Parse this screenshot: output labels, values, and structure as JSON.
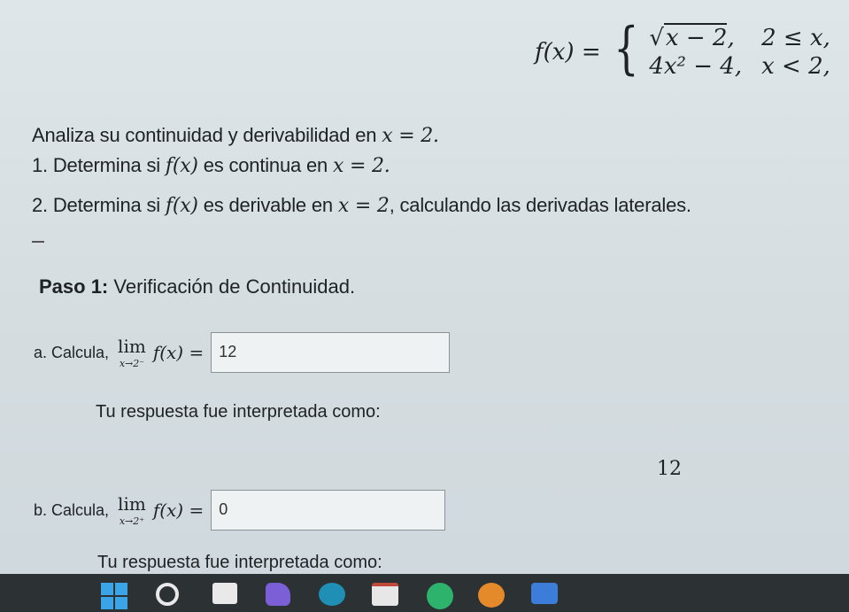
{
  "function": {
    "lhs": "f(x) =",
    "case1_expr": "x − 2",
    "case1_cond": "2 ≤ x,",
    "case2_expr": "4x² − 4,",
    "case2_cond": "x < 2,"
  },
  "statement": {
    "intro_text": "Analiza su continuidad y derivabilidad en",
    "intro_math": "x = 2.",
    "item1_a": "1. Determina si",
    "item1_fx": "f(x)",
    "item1_b": "es continua en",
    "item1_math": "x = 2.",
    "item2_a": "2. Determina si",
    "item2_fx": "f(x)",
    "item2_b": "es derivable en",
    "item2_math": "x = 2",
    "item2_c": ", calculando las derivadas laterales."
  },
  "separator": "---",
  "step1": {
    "label": "Paso 1:",
    "title": "Verificación de Continuidad."
  },
  "question_a": {
    "prefix": "a. Calcula,",
    "lim_word": "lim",
    "lim_sub": "x→2⁻",
    "fx": "f(x) =",
    "answer": "12"
  },
  "interpretation_a": {
    "label": "Tu respuesta fue interpretada como:",
    "value": "12"
  },
  "question_b": {
    "prefix": "b. Calcula,",
    "lim_word": "lim",
    "lim_sub": "x→2⁺",
    "fx": "f(x) =",
    "answer": "0"
  },
  "interpretation_b": {
    "label": "Tu respuesta fue interpretada como:"
  },
  "taskbar": {
    "icons": [
      "windows-start-icon",
      "search-icon",
      "file-explorer-icon",
      "app-icon",
      "browser-icon",
      "mail-icon",
      "chrome-icon",
      "firefox-icon",
      "app-icon"
    ]
  }
}
